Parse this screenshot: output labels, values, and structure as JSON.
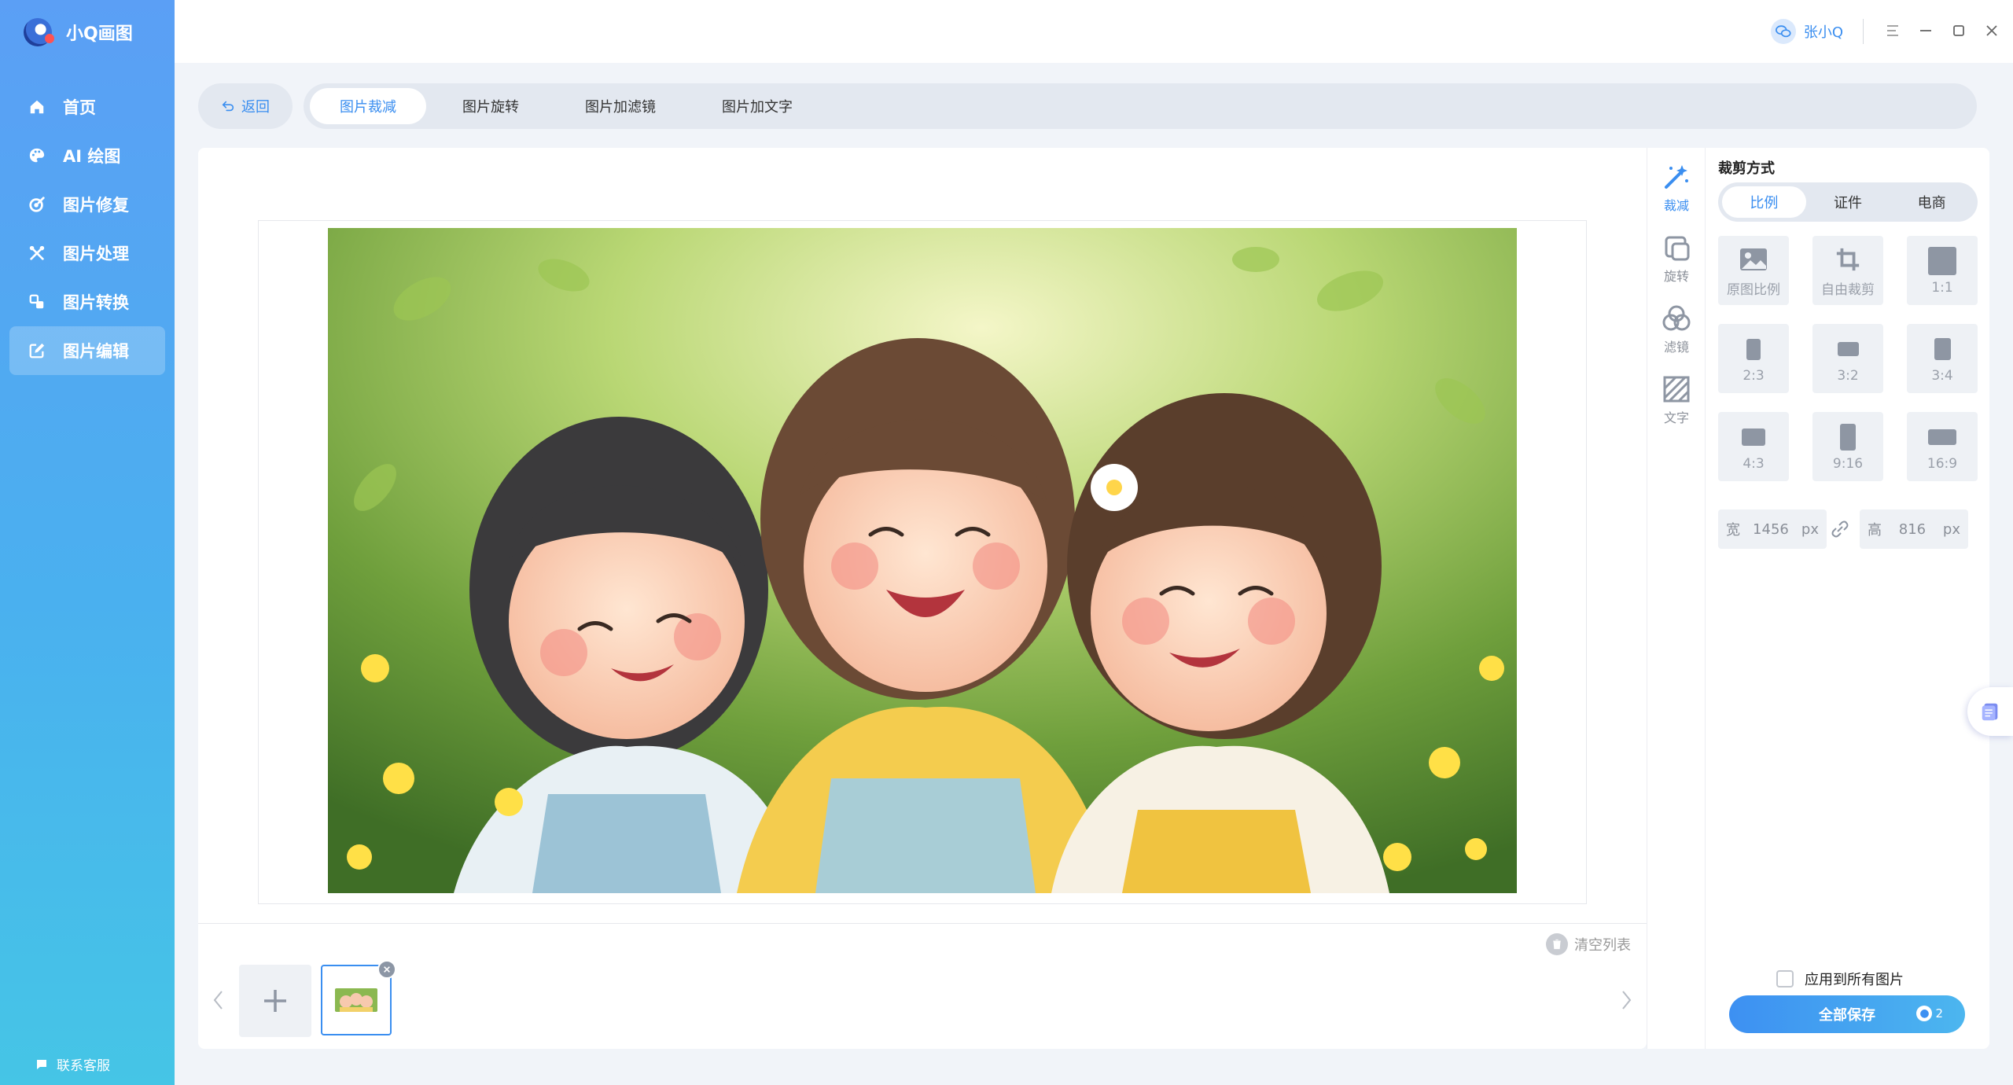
{
  "app": {
    "name": "小Q画图"
  },
  "sidebar": {
    "items": [
      {
        "label": "首页",
        "icon": "home-icon"
      },
      {
        "label": "AI 绘图",
        "icon": "palette-icon"
      },
      {
        "label": "图片修复",
        "icon": "repair-icon"
      },
      {
        "label": "图片处理",
        "icon": "tools-icon"
      },
      {
        "label": "图片转换",
        "icon": "convert-icon"
      },
      {
        "label": "图片编辑",
        "icon": "edit-icon",
        "active": true
      }
    ],
    "support_label": "联系客服"
  },
  "titlebar": {
    "user_name": "张小Q"
  },
  "toolbar": {
    "back_label": "返回",
    "tabs": [
      {
        "label": "图片裁减",
        "active": true
      },
      {
        "label": "图片旋转"
      },
      {
        "label": "图片加滤镜"
      },
      {
        "label": "图片加文字"
      }
    ]
  },
  "filmstrip": {
    "clear_label": "清空列表"
  },
  "rail": {
    "items": [
      {
        "label": "裁减",
        "icon": "magic-wand-icon",
        "active": true
      },
      {
        "label": "旋转",
        "icon": "rotate-icon"
      },
      {
        "label": "滤镜",
        "icon": "filter-icon"
      },
      {
        "label": "文字",
        "icon": "text-icon"
      }
    ]
  },
  "panel": {
    "title": "裁剪方式",
    "modes": [
      {
        "label": "比例",
        "active": true
      },
      {
        "label": "证件"
      },
      {
        "label": "电商"
      }
    ],
    "ratios": [
      {
        "label": "原图比例",
        "icon": "image-icon"
      },
      {
        "label": "自由裁剪",
        "icon": "crop-icon"
      },
      {
        "label": "1:1"
      },
      {
        "label": "2:3"
      },
      {
        "label": "3:2"
      },
      {
        "label": "3:4"
      },
      {
        "label": "4:3"
      },
      {
        "label": "9:16"
      },
      {
        "label": "16:9"
      }
    ],
    "width_label": "宽",
    "width_value": "1456",
    "width_unit": "px",
    "height_label": "高",
    "height_value": "816",
    "height_unit": "px",
    "apply_all_label": "应用到所有图片",
    "save_label": "全部保存",
    "save_count": "2"
  },
  "colors": {
    "accent": "#3a8ef0",
    "sidebar_top": "#5b9ff5",
    "sidebar_bottom": "#45c5e6"
  }
}
